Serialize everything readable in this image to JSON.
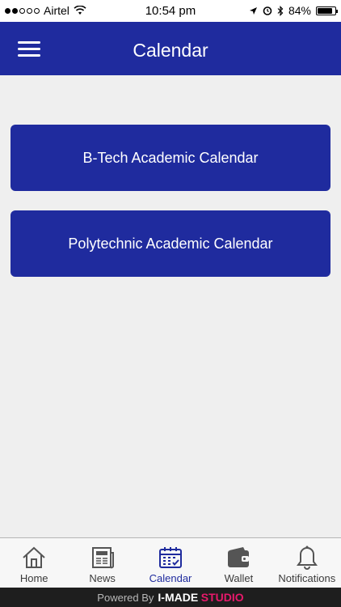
{
  "status_bar": {
    "carrier": "Airtel",
    "time": "10:54 pm",
    "battery": "84%",
    "battery_level": 0.84
  },
  "header": {
    "title": "Calendar"
  },
  "buttons": [
    {
      "label": "B-Tech Academic Calendar"
    },
    {
      "label": "Polytechnic Academic Calendar"
    }
  ],
  "tabs": [
    {
      "label": "Home",
      "icon": "home-icon"
    },
    {
      "label": "News",
      "icon": "news-icon"
    },
    {
      "label": "Calendar",
      "icon": "calendar-icon",
      "active": true
    },
    {
      "label": "Wallet",
      "icon": "wallet-icon"
    },
    {
      "label": "Notifications",
      "icon": "bell-icon"
    }
  ],
  "footer": {
    "prefix": "Powered By",
    "brand": "I-MADE",
    "brand_accent": "STUDIO"
  },
  "colors": {
    "primary": "#1f2b9e",
    "background": "#efefef",
    "brand_accent": "#e8196b"
  }
}
